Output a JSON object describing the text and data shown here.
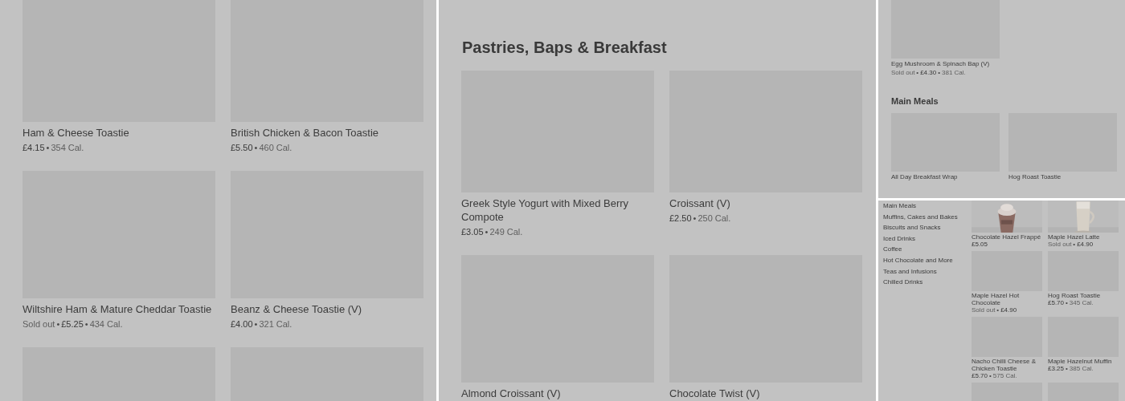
{
  "panels": [
    {
      "kind": "wide",
      "sections": [
        {
          "items": [
            {
              "name": "Ham & Cheese Toastie",
              "meta": [
                {
                  "kind": "price",
                  "text": "£4.15"
                },
                {
                  "kind": "separator",
                  "text": "•"
                },
                {
                  "kind": "calories",
                  "text": "354 Cal."
                }
              ]
            },
            {
              "name": "British Chicken & Bacon Toastie",
              "meta": [
                {
                  "kind": "price",
                  "text": "£5.50"
                },
                {
                  "kind": "separator",
                  "text": "•"
                },
                {
                  "kind": "calories",
                  "text": "460 Cal."
                }
              ]
            },
            {
              "name": "Wiltshire Ham & Mature Cheddar Toastie",
              "meta": [
                {
                  "kind": "status",
                  "text": "Sold out"
                },
                {
                  "kind": "separator",
                  "text": "•"
                },
                {
                  "kind": "price",
                  "text": "£5.25"
                },
                {
                  "kind": "separator",
                  "text": "•"
                },
                {
                  "kind": "calories",
                  "text": "434 Cal."
                }
              ]
            },
            {
              "name": "Beanz & Cheese Toastie (V)",
              "meta": [
                {
                  "kind": "price",
                  "text": "£4.00"
                },
                {
                  "kind": "separator",
                  "text": "•"
                },
                {
                  "kind": "calories",
                  "text": "321 Cal."
                }
              ]
            },
            {
              "kind": "blank"
            },
            {
              "kind": "blank"
            }
          ]
        }
      ]
    },
    {
      "kind": "wide",
      "sections": [
        {
          "title": "Pastries, Baps & Breakfast",
          "items": [
            {
              "name": "Greek Style Yogurt with Mixed Berry Compote",
              "meta": [
                {
                  "kind": "price",
                  "text": "£3.05"
                },
                {
                  "kind": "separator",
                  "text": "•"
                },
                {
                  "kind": "calories",
                  "text": "249 Cal."
                }
              ]
            },
            {
              "name": "Croissant (V)",
              "meta": [
                {
                  "kind": "price",
                  "text": "£2.50"
                },
                {
                  "kind": "separator",
                  "text": "•"
                },
                {
                  "kind": "calories",
                  "text": "250 Cal."
                }
              ]
            },
            {
              "name": "Almond Croissant (V)"
            },
            {
              "name": "Chocolate Twist (V)"
            }
          ]
        }
      ]
    },
    {
      "kind": "small",
      "sections": [
        {
          "items": [
            {
              "name": "Egg Mushroom & Spinach Bap (V)",
              "meta": [
                {
                  "kind": "status",
                  "text": "Sold out"
                },
                {
                  "kind": "separator",
                  "text": "•"
                },
                {
                  "kind": "price",
                  "text": "£4.30"
                },
                {
                  "kind": "separator",
                  "text": "•"
                },
                {
                  "kind": "calories",
                  "text": "381 Cal."
                }
              ]
            }
          ]
        },
        {
          "title": "Main Meals",
          "items": [
            {
              "name": "All Day Breakfast Wrap"
            },
            {
              "name": "Hog Roast Toastie"
            }
          ]
        }
      ]
    },
    {
      "kind": "tiny",
      "sidebar": [
        "Main Meals",
        "Muffins, Cakes and Bakes",
        "Biscuits and Snacks",
        "Iced Drinks",
        "Coffee",
        "Hot Chocolate and More",
        "Teas and Infusions",
        "Chilled Drinks"
      ],
      "sections": [
        {
          "items": [
            {
              "kind": "picture",
              "name": "Chocolate Hazel Frappé",
              "meta": [
                {
                  "kind": "price",
                  "text": "£5.05"
                }
              ]
            },
            {
              "kind": "picture",
              "name": "Maple Hazel Latte",
              "meta": [
                {
                  "kind": "status",
                  "text": "Sold out"
                },
                {
                  "kind": "separator",
                  "text": "•"
                },
                {
                  "kind": "price",
                  "text": "£4.90"
                }
              ]
            },
            {
              "name": "Maple Hazel Hot Chocolate",
              "meta": [
                {
                  "kind": "status",
                  "text": "Sold out"
                },
                {
                  "kind": "separator",
                  "text": "•"
                },
                {
                  "kind": "price",
                  "text": "£4.90"
                }
              ]
            },
            {
              "name": "Hog Roast Toastie",
              "meta": [
                {
                  "kind": "price",
                  "text": "£5.70"
                },
                {
                  "kind": "separator",
                  "text": "•"
                },
                {
                  "kind": "calories",
                  "text": "345 Cal."
                }
              ]
            },
            {
              "name": "Nacho Chilli Cheese & Chicken Toastie",
              "meta": [
                {
                  "kind": "price",
                  "text": "£5.70"
                },
                {
                  "kind": "separator",
                  "text": "•"
                },
                {
                  "kind": "calories",
                  "text": "575 Cal."
                }
              ]
            },
            {
              "name": "Maple Hazelnut Muffin",
              "meta": [
                {
                  "kind": "price",
                  "text": "£3.25"
                },
                {
                  "kind": "separator",
                  "text": "•"
                },
                {
                  "kind": "calories",
                  "text": "385 Cal."
                }
              ]
            },
            {
              "kind": "blank"
            },
            {
              "kind": "blank"
            }
          ]
        }
      ]
    }
  ]
}
